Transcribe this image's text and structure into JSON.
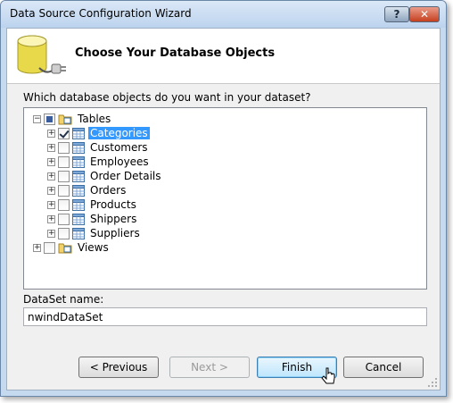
{
  "window": {
    "title": "Data Source Configuration Wizard"
  },
  "titlebar": {
    "help_label": "?",
    "close_label": "✕"
  },
  "header": {
    "title": "Choose Your Database Objects"
  },
  "question": "Which database objects do you want in your dataset?",
  "tree": {
    "tables_label": "Tables",
    "tables": [
      {
        "label": "Categories",
        "checked": true,
        "selected": true
      },
      {
        "label": "Customers",
        "checked": false
      },
      {
        "label": "Employees",
        "checked": false
      },
      {
        "label": "Order Details",
        "checked": false
      },
      {
        "label": "Orders",
        "checked": false
      },
      {
        "label": "Products",
        "checked": false
      },
      {
        "label": "Shippers",
        "checked": false
      },
      {
        "label": "Suppliers",
        "checked": false
      }
    ],
    "views_label": "Views"
  },
  "dataset": {
    "label": "DataSet name:",
    "value": "nwindDataSet"
  },
  "buttons": {
    "previous": "< Previous",
    "next": "Next >",
    "finish": "Finish",
    "cancel": "Cancel"
  },
  "icons": {
    "database": "database-plug-icon",
    "table": "table-icon",
    "folder": "folder-icon",
    "cursor": "pointer-cursor-icon"
  },
  "colors": {
    "selection": "#3399ff",
    "titlebar": "#c5d9ef",
    "close": "#c7401f"
  }
}
